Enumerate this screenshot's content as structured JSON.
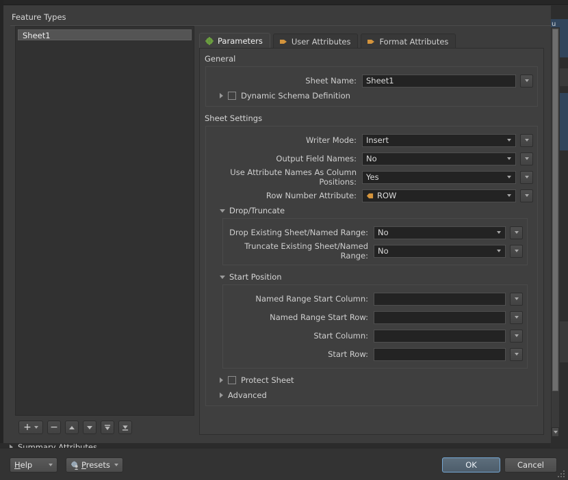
{
  "window": {
    "section_title": "Feature Types"
  },
  "feature_types": {
    "items": [
      {
        "label": "Sheet1",
        "selected": true
      }
    ],
    "toolbar": [
      {
        "name": "add-feature-type-button",
        "icon": "plus-icon",
        "label": "+"
      },
      {
        "name": "remove-feature-type-button",
        "icon": "minus-icon",
        "label": "−"
      },
      {
        "name": "move-up-button",
        "icon": "triangle-up-icon",
        "label": ""
      },
      {
        "name": "move-down-button",
        "icon": "triangle-down-icon",
        "label": ""
      },
      {
        "name": "move-to-top-button",
        "icon": "move-to-top-icon",
        "label": ""
      },
      {
        "name": "move-to-bottom-button",
        "icon": "move-to-bottom-icon",
        "label": ""
      }
    ]
  },
  "tabs": [
    {
      "label": "Parameters",
      "icon": "green-gear-icon",
      "active": true
    },
    {
      "label": "User Attributes",
      "icon": "orange-arrow-icon",
      "active": false
    },
    {
      "label": "Format Attributes",
      "icon": "orange-arrow-icon",
      "active": false
    }
  ],
  "general": {
    "group_label": "General",
    "sheet_name": {
      "label": "Sheet Name:",
      "value": "Sheet1"
    },
    "dynamic_schema": {
      "label": "Dynamic Schema Definition",
      "checked": false,
      "expanded": false
    }
  },
  "sheet_settings": {
    "group_label": "Sheet Settings",
    "rows": [
      {
        "label": "Writer Mode:",
        "value": "Insert",
        "dropdown": true
      },
      {
        "label": "Output Field Names:",
        "value": "No",
        "dropdown": true
      },
      {
        "label": "Use Attribute Names As Column Positions:",
        "value": "Yes",
        "dropdown": true
      },
      {
        "label": "Row Number Attribute:",
        "value": "ROW",
        "dropdown": true,
        "icon": "orange-attribute-icon"
      }
    ],
    "drop_truncate": {
      "label": "Drop/Truncate",
      "expanded": true,
      "rows": [
        {
          "label": "Drop Existing Sheet/Named Range:",
          "value": "No",
          "dropdown": true
        },
        {
          "label": "Truncate Existing Sheet/Named Range:",
          "value": "No",
          "dropdown": true
        }
      ]
    },
    "start_position": {
      "label": "Start Position",
      "expanded": true,
      "rows": [
        {
          "label": "Named Range Start Column:",
          "value": "",
          "dropdown": false
        },
        {
          "label": "Named Range Start Row:",
          "value": "",
          "dropdown": false
        },
        {
          "label": "Start Column:",
          "value": "",
          "dropdown": false
        },
        {
          "label": "Start Row:",
          "value": "",
          "dropdown": false
        }
      ]
    },
    "protect_sheet": {
      "label": "Protect Sheet",
      "checked": false,
      "expanded": false
    },
    "advanced": {
      "label": "Advanced",
      "expanded": false
    }
  },
  "summary_attributes": {
    "label": "Summary Attributes",
    "expanded": false
  },
  "bottom_bar": {
    "help": "Help",
    "presets": "Presets",
    "ok": "OK",
    "cancel": "Cancel"
  },
  "colors": {
    "accent_blue": "#76a9d6",
    "attribute_orange": "#d4943c",
    "gear_green": "#6b9f3f",
    "panel_bg": "#3f3f3f",
    "dialog_bg": "#3c3c3c",
    "field_bg": "#232323"
  }
}
